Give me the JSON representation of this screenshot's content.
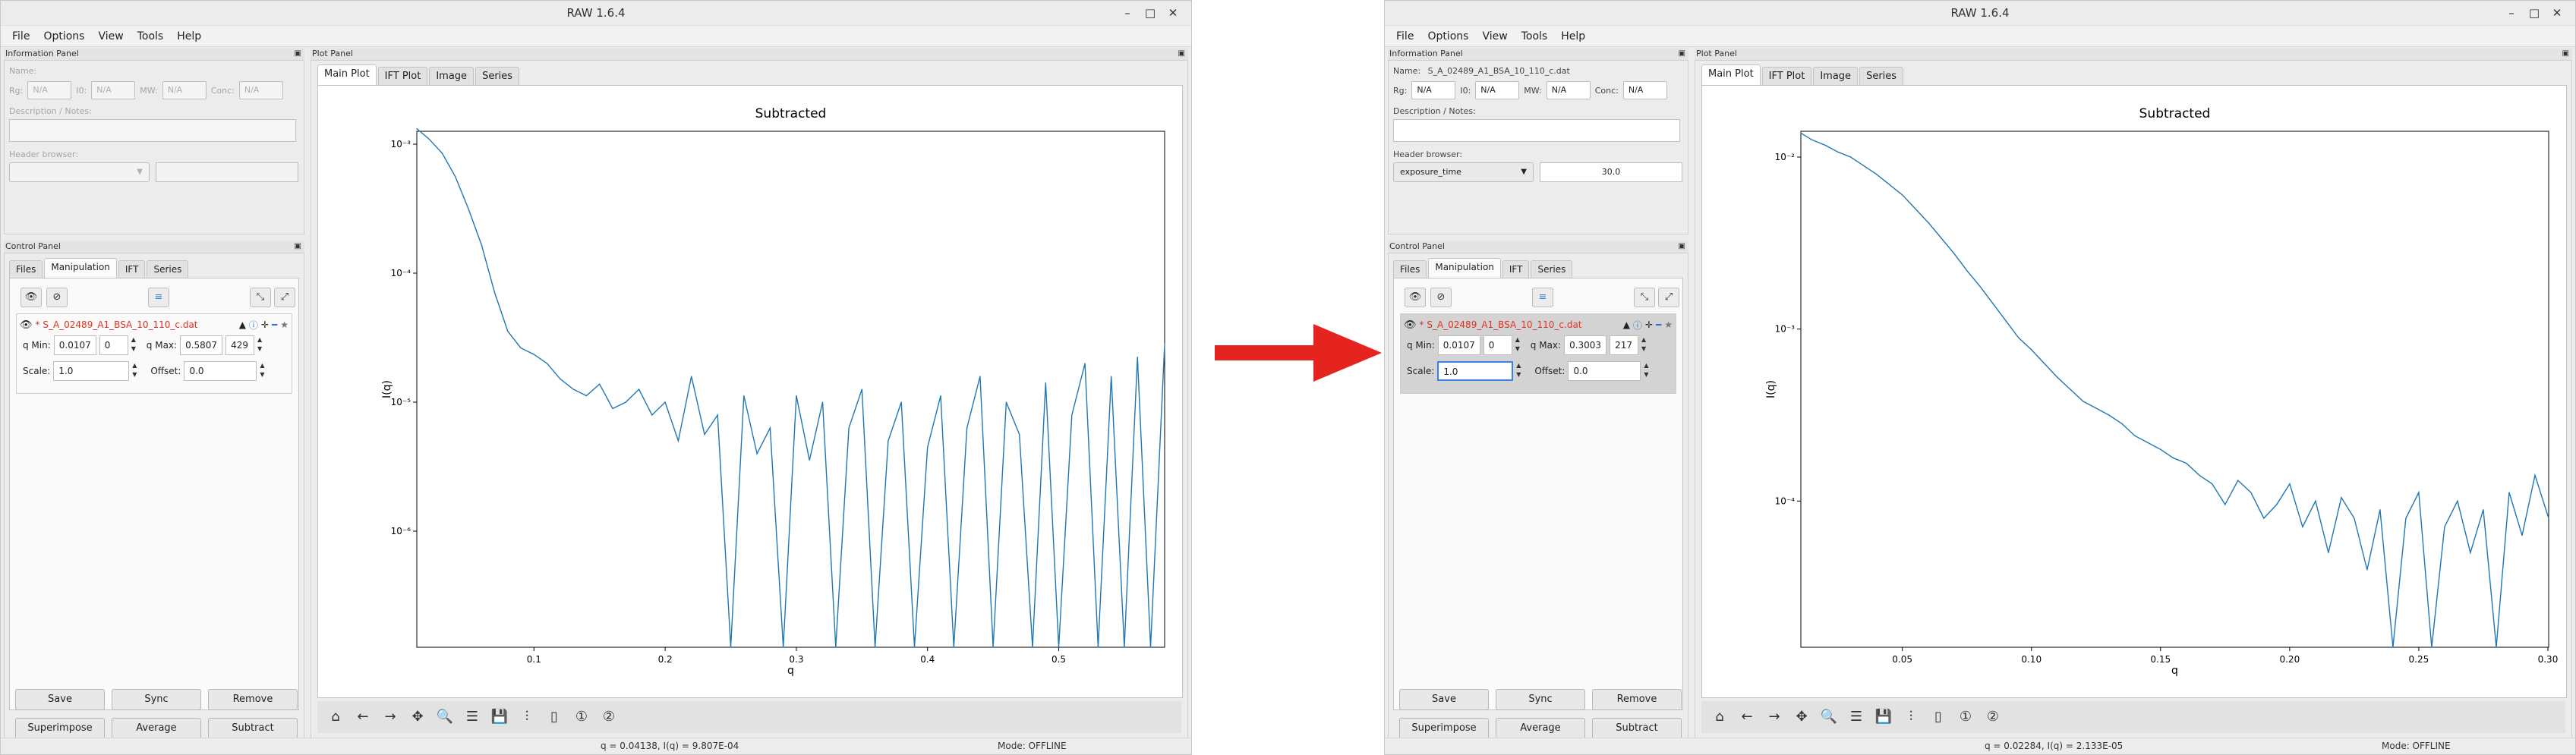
{
  "arrow_color": "#e52420",
  "plot_color": "#1f77b4",
  "windows": [
    {
      "side": "left",
      "title": "RAW 1.6.4",
      "menu": [
        "File",
        "Options",
        "View",
        "Tools",
        "Help"
      ],
      "info_panel": {
        "header": "Information Panel",
        "name_label": "Name:",
        "name_value": "",
        "fields": [
          {
            "label": "Rg:",
            "value": "N/A"
          },
          {
            "label": "I0:",
            "value": "N/A"
          },
          {
            "label": "MW:",
            "value": "N/A"
          },
          {
            "label": "Conc:",
            "value": "N/A"
          }
        ],
        "desc_label": "Description / Notes:",
        "header_browser_label": "Header browser:",
        "header_browser_key": "",
        "header_browser_value": "",
        "disabled": true
      },
      "control_panel": {
        "header": "Control Panel",
        "tabs": [
          "Files",
          "Manipulation",
          "IFT",
          "Series"
        ],
        "active_tab": "Manipulation",
        "item": {
          "filename": "* S_A_02489_A1_BSA_10_110_c.dat",
          "qmin_label": "q Min:",
          "qmin_value": "0.0107",
          "qmin_index": "0",
          "qmax_label": "q Max:",
          "qmax_value": "0.5807",
          "qmax_index": "429",
          "scale_label": "Scale:",
          "scale_value": "1.0",
          "offset_label": "Offset:",
          "offset_value": "0.0",
          "selected": false
        },
        "buttons": [
          "Save",
          "Sync",
          "Remove",
          "Superimpose",
          "Average",
          "Subtract"
        ]
      },
      "plot_panel": {
        "header": "Plot Panel",
        "tabs": [
          "Main Plot",
          "IFT Plot",
          "Image",
          "Series"
        ],
        "active_tab": "Main Plot"
      },
      "status": {
        "coord": "q = 0.04138, I(q) = 9.807E-04",
        "mode": "Mode: OFFLINE"
      },
      "chart_data": {
        "type": "line",
        "title": "Subtracted",
        "xlabel": "q",
        "ylabel": "I(q)",
        "yscale": "log",
        "xlim": [
          0.0107,
          0.5807
        ],
        "ylim_exp": [
          -6.9,
          -2.9
        ],
        "xticks": [
          0.1,
          0.2,
          0.3,
          0.4,
          0.5
        ],
        "yticks": [
          "10⁻³",
          "10⁻⁴",
          "10⁻⁵",
          "10⁻⁶"
        ],
        "ytick_exp": [
          -3,
          -4,
          -5,
          -6
        ],
        "x": [
          0.0107,
          0.02,
          0.03,
          0.04,
          0.05,
          0.06,
          0.07,
          0.08,
          0.09,
          0.1,
          0.11,
          0.12,
          0.13,
          0.14,
          0.15,
          0.16,
          0.17,
          0.18,
          0.19,
          0.2,
          0.21,
          0.22,
          0.23,
          0.24,
          0.25,
          0.26,
          0.27,
          0.28,
          0.29,
          0.3,
          0.31,
          0.32,
          0.33,
          0.34,
          0.35,
          0.36,
          0.37,
          0.38,
          0.39,
          0.4,
          0.41,
          0.42,
          0.43,
          0.44,
          0.45,
          0.46,
          0.47,
          0.48,
          0.49,
          0.5,
          0.51,
          0.52,
          0.53,
          0.54,
          0.55,
          0.56,
          0.57,
          0.5807
        ],
        "y_exp": [
          -2.88,
          -2.96,
          -3.07,
          -3.25,
          -3.5,
          -3.78,
          -4.15,
          -4.45,
          -4.58,
          -4.63,
          -4.7,
          -4.82,
          -4.9,
          -4.95,
          -4.86,
          -5.05,
          -5.0,
          -4.9,
          -5.1,
          -5.0,
          -5.3,
          -4.8,
          -5.25,
          -5.1,
          -6.9,
          -4.95,
          -5.4,
          -5.2,
          -6.9,
          -4.95,
          -5.45,
          -5.0,
          -6.9,
          -5.2,
          -4.9,
          -6.9,
          -5.3,
          -5.0,
          -6.9,
          -5.35,
          -4.95,
          -6.9,
          -5.2,
          -4.8,
          -6.9,
          -5.0,
          -5.25,
          -6.9,
          -4.85,
          -6.9,
          -5.1,
          -4.7,
          -6.9,
          -4.8,
          -6.9,
          -4.65,
          -6.9,
          -4.55
        ]
      }
    },
    {
      "side": "right",
      "title": "RAW 1.6.4",
      "menu": [
        "File",
        "Options",
        "View",
        "Tools",
        "Help"
      ],
      "info_panel": {
        "header": "Information Panel",
        "name_label": "Name:",
        "name_value": "S_A_02489_A1_BSA_10_110_c.dat",
        "fields": [
          {
            "label": "Rg:",
            "value": "N/A"
          },
          {
            "label": "I0:",
            "value": "N/A"
          },
          {
            "label": "MW:",
            "value": "N/A"
          },
          {
            "label": "Conc:",
            "value": "N/A"
          }
        ],
        "desc_label": "Description / Notes:",
        "header_browser_label": "Header browser:",
        "header_browser_key": "exposure_time",
        "header_browser_value": "30.0",
        "disabled": false
      },
      "control_panel": {
        "header": "Control Panel",
        "tabs": [
          "Files",
          "Manipulation",
          "IFT",
          "Series"
        ],
        "active_tab": "Manipulation",
        "item": {
          "filename": "* S_A_02489_A1_BSA_10_110_c.dat",
          "qmin_label": "q Min:",
          "qmin_value": "0.0107",
          "qmin_index": "0",
          "qmax_label": "q Max:",
          "qmax_value": "0.3003",
          "qmax_index": "217",
          "scale_label": "Scale:",
          "scale_value": "1.0",
          "offset_label": "Offset:",
          "offset_value": "0.0",
          "selected": true
        },
        "buttons": [
          "Save",
          "Sync",
          "Remove",
          "Superimpose",
          "Average",
          "Subtract"
        ]
      },
      "plot_panel": {
        "header": "Plot Panel",
        "tabs": [
          "Main Plot",
          "IFT Plot",
          "Image",
          "Series"
        ],
        "active_tab": "Main Plot"
      },
      "status": {
        "coord": "q = 0.02284, I(q) = 2.133E-05",
        "mode": "Mode: OFFLINE"
      },
      "chart_data": {
        "type": "line",
        "title": "Subtracted",
        "xlabel": "q",
        "ylabel": "I(q)",
        "yscale": "log",
        "xlim": [
          0.0107,
          0.3003
        ],
        "ylim_exp": [
          -4.85,
          -1.85
        ],
        "xticks": [
          0.05,
          0.1,
          0.15,
          0.2,
          0.25,
          0.3
        ],
        "xtick_labels": [
          "0.05",
          "0.10",
          "0.15",
          "0.20",
          "0.25",
          "0.30"
        ],
        "yticks": [
          "10⁻²",
          "10⁻³",
          "10⁻⁴"
        ],
        "ytick_exp": [
          -2,
          -3,
          -4
        ],
        "x": [
          0.0107,
          0.015,
          0.02,
          0.025,
          0.03,
          0.035,
          0.04,
          0.045,
          0.05,
          0.055,
          0.06,
          0.065,
          0.07,
          0.075,
          0.08,
          0.085,
          0.09,
          0.095,
          0.1,
          0.105,
          0.11,
          0.115,
          0.12,
          0.125,
          0.13,
          0.135,
          0.14,
          0.145,
          0.15,
          0.155,
          0.16,
          0.165,
          0.17,
          0.175,
          0.18,
          0.185,
          0.19,
          0.195,
          0.2,
          0.205,
          0.21,
          0.215,
          0.22,
          0.225,
          0.23,
          0.235,
          0.24,
          0.245,
          0.25,
          0.255,
          0.26,
          0.265,
          0.27,
          0.275,
          0.28,
          0.285,
          0.29,
          0.295,
          0.3003
        ],
        "y_exp": [
          -1.86,
          -1.9,
          -1.93,
          -1.97,
          -2.0,
          -2.05,
          -2.1,
          -2.16,
          -2.22,
          -2.3,
          -2.38,
          -2.47,
          -2.56,
          -2.66,
          -2.75,
          -2.85,
          -2.95,
          -3.05,
          -3.12,
          -3.2,
          -3.28,
          -3.35,
          -3.42,
          -3.46,
          -3.5,
          -3.55,
          -3.62,
          -3.66,
          -3.7,
          -3.75,
          -3.78,
          -3.85,
          -3.9,
          -4.02,
          -3.88,
          -3.95,
          -4.1,
          -4.02,
          -3.9,
          -4.15,
          -4.0,
          -4.3,
          -3.98,
          -4.1,
          -4.4,
          -4.05,
          -4.85,
          -4.1,
          -3.95,
          -4.85,
          -4.15,
          -4.0,
          -4.3,
          -4.05,
          -4.85,
          -3.95,
          -4.2,
          -3.85,
          -4.1
        ]
      }
    }
  ]
}
